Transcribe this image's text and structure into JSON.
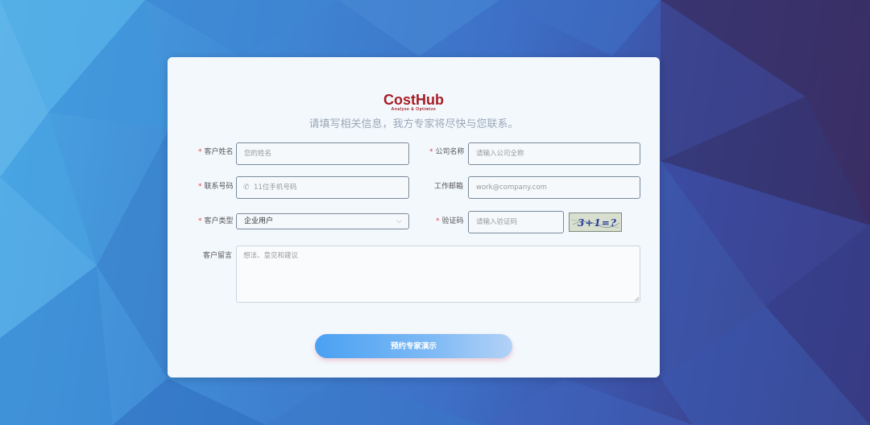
{
  "brand": {
    "name": "CostHub",
    "tagline": "Analyse & Optimize",
    "color": "#a51d24"
  },
  "subtitle": "请填写相关信息，我方专家将尽快与您联系。",
  "form": {
    "customer_name": {
      "label": "客户姓名",
      "required": "*",
      "placeholder": "您的姓名"
    },
    "company_name": {
      "label": "公司名称",
      "required": "*",
      "placeholder": "请输入公司全称"
    },
    "phone": {
      "label": "联系号码",
      "required": "*",
      "placeholder": "11位手机号码",
      "icon": "phone-icon"
    },
    "email": {
      "label": "工作邮箱",
      "placeholder": "work@company.com"
    },
    "customer_type": {
      "label": "客户类型",
      "required": "*",
      "value": "企业用户",
      "icon": "chevron-down-icon"
    },
    "captcha": {
      "label": "验证码",
      "required": "*",
      "placeholder": "请输入验证码",
      "image_text": "3+1=?"
    },
    "message": {
      "label": "客户留言",
      "placeholder": "想法、意见和建议"
    },
    "submit_label": "预约专家演示"
  },
  "colors": {
    "required": "#e04b4b",
    "button_start": "#4aa1f2",
    "button_end": "#b3d2f6"
  }
}
